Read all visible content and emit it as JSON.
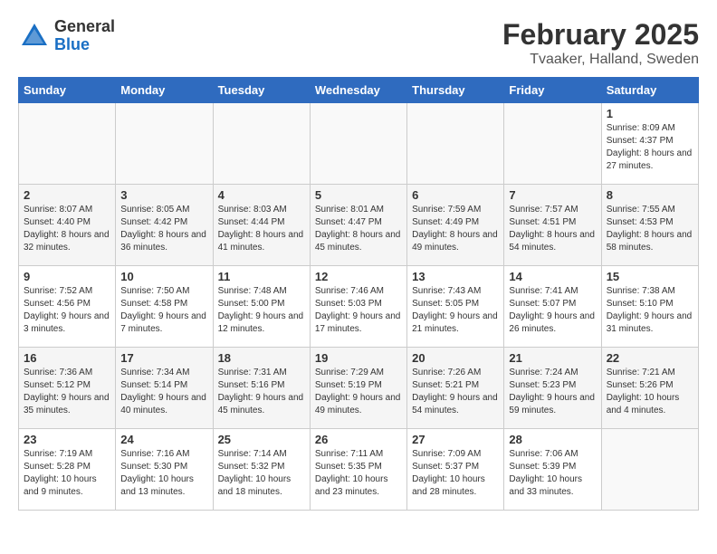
{
  "header": {
    "logo_general": "General",
    "logo_blue": "Blue",
    "main_title": "February 2025",
    "subtitle": "Tvaaker, Halland, Sweden"
  },
  "days_of_week": [
    "Sunday",
    "Monday",
    "Tuesday",
    "Wednesday",
    "Thursday",
    "Friday",
    "Saturday"
  ],
  "weeks": [
    [
      {
        "day": "",
        "info": ""
      },
      {
        "day": "",
        "info": ""
      },
      {
        "day": "",
        "info": ""
      },
      {
        "day": "",
        "info": ""
      },
      {
        "day": "",
        "info": ""
      },
      {
        "day": "",
        "info": ""
      },
      {
        "day": "1",
        "info": "Sunrise: 8:09 AM\nSunset: 4:37 PM\nDaylight: 8 hours and 27 minutes."
      }
    ],
    [
      {
        "day": "2",
        "info": "Sunrise: 8:07 AM\nSunset: 4:40 PM\nDaylight: 8 hours and 32 minutes."
      },
      {
        "day": "3",
        "info": "Sunrise: 8:05 AM\nSunset: 4:42 PM\nDaylight: 8 hours and 36 minutes."
      },
      {
        "day": "4",
        "info": "Sunrise: 8:03 AM\nSunset: 4:44 PM\nDaylight: 8 hours and 41 minutes."
      },
      {
        "day": "5",
        "info": "Sunrise: 8:01 AM\nSunset: 4:47 PM\nDaylight: 8 hours and 45 minutes."
      },
      {
        "day": "6",
        "info": "Sunrise: 7:59 AM\nSunset: 4:49 PM\nDaylight: 8 hours and 49 minutes."
      },
      {
        "day": "7",
        "info": "Sunrise: 7:57 AM\nSunset: 4:51 PM\nDaylight: 8 hours and 54 minutes."
      },
      {
        "day": "8",
        "info": "Sunrise: 7:55 AM\nSunset: 4:53 PM\nDaylight: 8 hours and 58 minutes."
      }
    ],
    [
      {
        "day": "9",
        "info": "Sunrise: 7:52 AM\nSunset: 4:56 PM\nDaylight: 9 hours and 3 minutes."
      },
      {
        "day": "10",
        "info": "Sunrise: 7:50 AM\nSunset: 4:58 PM\nDaylight: 9 hours and 7 minutes."
      },
      {
        "day": "11",
        "info": "Sunrise: 7:48 AM\nSunset: 5:00 PM\nDaylight: 9 hours and 12 minutes."
      },
      {
        "day": "12",
        "info": "Sunrise: 7:46 AM\nSunset: 5:03 PM\nDaylight: 9 hours and 17 minutes."
      },
      {
        "day": "13",
        "info": "Sunrise: 7:43 AM\nSunset: 5:05 PM\nDaylight: 9 hours and 21 minutes."
      },
      {
        "day": "14",
        "info": "Sunrise: 7:41 AM\nSunset: 5:07 PM\nDaylight: 9 hours and 26 minutes."
      },
      {
        "day": "15",
        "info": "Sunrise: 7:38 AM\nSunset: 5:10 PM\nDaylight: 9 hours and 31 minutes."
      }
    ],
    [
      {
        "day": "16",
        "info": "Sunrise: 7:36 AM\nSunset: 5:12 PM\nDaylight: 9 hours and 35 minutes."
      },
      {
        "day": "17",
        "info": "Sunrise: 7:34 AM\nSunset: 5:14 PM\nDaylight: 9 hours and 40 minutes."
      },
      {
        "day": "18",
        "info": "Sunrise: 7:31 AM\nSunset: 5:16 PM\nDaylight: 9 hours and 45 minutes."
      },
      {
        "day": "19",
        "info": "Sunrise: 7:29 AM\nSunset: 5:19 PM\nDaylight: 9 hours and 49 minutes."
      },
      {
        "day": "20",
        "info": "Sunrise: 7:26 AM\nSunset: 5:21 PM\nDaylight: 9 hours and 54 minutes."
      },
      {
        "day": "21",
        "info": "Sunrise: 7:24 AM\nSunset: 5:23 PM\nDaylight: 9 hours and 59 minutes."
      },
      {
        "day": "22",
        "info": "Sunrise: 7:21 AM\nSunset: 5:26 PM\nDaylight: 10 hours and 4 minutes."
      }
    ],
    [
      {
        "day": "23",
        "info": "Sunrise: 7:19 AM\nSunset: 5:28 PM\nDaylight: 10 hours and 9 minutes."
      },
      {
        "day": "24",
        "info": "Sunrise: 7:16 AM\nSunset: 5:30 PM\nDaylight: 10 hours and 13 minutes."
      },
      {
        "day": "25",
        "info": "Sunrise: 7:14 AM\nSunset: 5:32 PM\nDaylight: 10 hours and 18 minutes."
      },
      {
        "day": "26",
        "info": "Sunrise: 7:11 AM\nSunset: 5:35 PM\nDaylight: 10 hours and 23 minutes."
      },
      {
        "day": "27",
        "info": "Sunrise: 7:09 AM\nSunset: 5:37 PM\nDaylight: 10 hours and 28 minutes."
      },
      {
        "day": "28",
        "info": "Sunrise: 7:06 AM\nSunset: 5:39 PM\nDaylight: 10 hours and 33 minutes."
      },
      {
        "day": "",
        "info": ""
      }
    ]
  ]
}
